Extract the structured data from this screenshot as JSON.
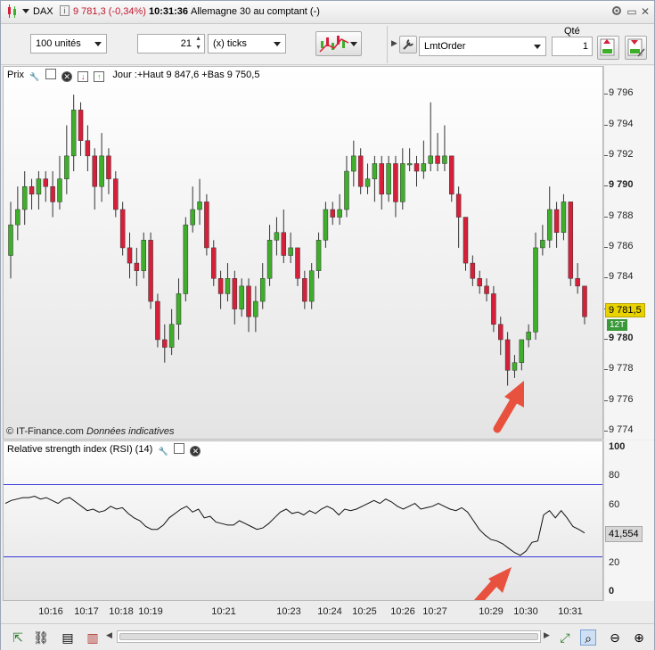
{
  "titlebar": {
    "symbol": "DAX",
    "price_change": "9 781,3 (-0,34%)",
    "time": "10:31:36",
    "instrument": "Allemagne 30 au comptant (-)"
  },
  "toolbar": {
    "quantity_units": "100 unités",
    "ticks_value": "21",
    "ticks_unit": "(x) ticks",
    "order_type": "LmtOrder",
    "qty_label": "Qté",
    "qty_value": "1"
  },
  "price_panel": {
    "label": "Prix",
    "info": "Jour :+Haut 9 847,6 +Bas 9 750,5",
    "credit_source": "© IT-Finance.com",
    "credit_note": "Données indicatives",
    "y_ticks": [
      "9 796",
      "9 794",
      "9 792",
      "9 790",
      "9 788",
      "9 786",
      "9 784",
      "9 782",
      "9 780",
      "9 778",
      "9 776",
      "9 774"
    ],
    "current_price": "9 781,5",
    "tick_badge": "12T"
  },
  "rsi_panel": {
    "label": "Relative strength index (RSI) (14)",
    "y_ticks": [
      "100",
      "80",
      "60",
      "40",
      "20",
      "0"
    ],
    "current_value": "41,554"
  },
  "x_axis": {
    "labels": [
      "10:16",
      "10:17",
      "10:18",
      "10:19",
      "10:21",
      "10:23",
      "10:24",
      "10:25",
      "10:26",
      "10:27",
      "10:29",
      "10:30",
      "10:31"
    ]
  },
  "colors": {
    "up_candle": "#3fae2a",
    "down_candle": "#d6203a",
    "rsi_band": "#3b3bd6",
    "arrow": "#e8513e",
    "price_tag": "#e8d200"
  },
  "chart_data": [
    {
      "type": "candlestick",
      "title": "",
      "ylim": [
        9774,
        9797
      ],
      "x_labels": [
        "10:16",
        "10:17",
        "10:18",
        "10:19",
        "10:21",
        "10:23",
        "10:24",
        "10:25",
        "10:26",
        "10:27",
        "10:29",
        "10:30",
        "10:31"
      ],
      "candles": [
        [
          9785.5,
          9787.5,
          9784,
          9789
        ],
        [
          9787.5,
          9788.5,
          9786.5,
          9790
        ],
        [
          9788.5,
          9790,
          9787.5,
          9791
        ],
        [
          9790,
          9789.5,
          9788.5,
          9790.5
        ],
        [
          9789.5,
          9790.5,
          9788.5,
          9791
        ],
        [
          9790.5,
          9790,
          9789,
          9791
        ],
        [
          9790,
          9789,
          9788,
          9791
        ],
        [
          9789,
          9790.5,
          9788.5,
          9792
        ],
        [
          9790.5,
          9792,
          9789.5,
          9794
        ],
        [
          9792,
          9795,
          9791,
          9796
        ],
        [
          9795,
          9793,
          9792,
          9795.5
        ],
        [
          9793,
          9792,
          9791,
          9794
        ],
        [
          9792,
          9790,
          9788.5,
          9792.5
        ],
        [
          9790,
          9792,
          9789,
          9793.5
        ],
        [
          9792,
          9790.5,
          9789.5,
          9792.5
        ],
        [
          9790.5,
          9788.5,
          9788,
          9791
        ],
        [
          9788.5,
          9786,
          9785.5,
          9789
        ],
        [
          9786,
          9785,
          9784,
          9787
        ],
        [
          9785,
          9784.5,
          9783.5,
          9786
        ],
        [
          9784.5,
          9786.5,
          9784,
          9787
        ],
        [
          9786.5,
          9782.5,
          9782,
          9787
        ],
        [
          9782.5,
          9780,
          9779.5,
          9783
        ],
        [
          9780,
          9779.5,
          9778.5,
          9781
        ],
        [
          9779.5,
          9781,
          9779,
          9782
        ],
        [
          9781,
          9783,
          9780,
          9784
        ],
        [
          9783,
          9787.5,
          9782.5,
          9788
        ],
        [
          9787.5,
          9788.5,
          9787,
          9790
        ],
        [
          9788.5,
          9789,
          9787.5,
          9790.5
        ],
        [
          9789,
          9786,
          9785.5,
          9789.5
        ],
        [
          9786,
          9784,
          9783.5,
          9786.5
        ],
        [
          9784,
          9783,
          9782,
          9784.5
        ],
        [
          9783,
          9784,
          9782.5,
          9785
        ],
        [
          9784,
          9782,
          9781,
          9784.5
        ],
        [
          9782,
          9783.5,
          9781.5,
          9784
        ],
        [
          9783.5,
          9781.5,
          9780.5,
          9784
        ],
        [
          9781.5,
          9782.5,
          9780.5,
          9783.5
        ],
        [
          9782.5,
          9784,
          9782,
          9785
        ],
        [
          9784,
          9786.5,
          9783.5,
          9787.5
        ],
        [
          9786.5,
          9787,
          9785.5,
          9788
        ],
        [
          9787,
          9785.5,
          9785,
          9788.5
        ],
        [
          9785.5,
          9786,
          9785,
          9787
        ],
        [
          9786,
          9784,
          9783.5,
          9786
        ],
        [
          9784,
          9782.5,
          9782,
          9784.5
        ],
        [
          9782.5,
          9784.5,
          9782,
          9785
        ],
        [
          9784.5,
          9786.5,
          9784,
          9787
        ],
        [
          9786.5,
          9788.5,
          9786,
          9789
        ],
        [
          9788.5,
          9788,
          9787.5,
          9789
        ],
        [
          9788,
          9788.5,
          9787.5,
          9789.5
        ],
        [
          9788.5,
          9791,
          9788,
          9792
        ],
        [
          9791,
          9792,
          9790,
          9793
        ],
        [
          9792,
          9790,
          9789.5,
          9792.5
        ],
        [
          9790,
          9790.5,
          9789.5,
          9791.5
        ],
        [
          9790.5,
          9791.5,
          9789,
          9792
        ],
        [
          9791.5,
          9789.5,
          9788.5,
          9792
        ],
        [
          9789.5,
          9791.5,
          9789,
          9792
        ],
        [
          9791.5,
          9789,
          9788,
          9792
        ],
        [
          9789,
          9791.5,
          9788.5,
          9792.5
        ],
        [
          9791.5,
          9791.5,
          9791,
          9792.5
        ],
        [
          9791.5,
          9791,
          9790,
          9792
        ],
        [
          9791,
          9791.5,
          9790.5,
          9793
        ],
        [
          9791.5,
          9792,
          9791,
          9795.5
        ],
        [
          9792,
          9791.5,
          9791,
          9793.5
        ],
        [
          9791.5,
          9792,
          9791,
          9794
        ],
        [
          9792,
          9789.5,
          9789,
          9792
        ],
        [
          9789.5,
          9788,
          9786,
          9790
        ],
        [
          9788,
          9785,
          9784.5,
          9788
        ],
        [
          9785,
          9784,
          9783.5,
          9785.5
        ],
        [
          9784,
          9783.5,
          9783,
          9784.5
        ],
        [
          9783.5,
          9783,
          9782.5,
          9784
        ],
        [
          9783,
          9781,
          9780.5,
          9783.5
        ],
        [
          9781,
          9780,
          9779,
          9781.5
        ],
        [
          9780,
          9778,
          9777,
          9780.5
        ],
        [
          9778,
          9778.5,
          9777.5,
          9779
        ],
        [
          9778.5,
          9780,
          9778,
          9780
        ],
        [
          9780,
          9780.5,
          9779.5,
          9781
        ],
        [
          9780.5,
          9786,
          9780,
          9787
        ],
        [
          9786,
          9786.5,
          9785.5,
          9787.5
        ],
        [
          9786.5,
          9788.5,
          9786,
          9790
        ],
        [
          9788.5,
          9787,
          9786,
          9789
        ],
        [
          9787,
          9789,
          9786.5,
          9789.5
        ],
        [
          9789,
          9784,
          9783.5,
          9789
        ],
        [
          9784,
          9783.5,
          9783,
          9785
        ],
        [
          9783.5,
          9781.5,
          9781,
          9783.5
        ]
      ]
    },
    {
      "type": "line",
      "title": "",
      "ylim": [
        0,
        100
      ],
      "bands": [
        25,
        75
      ],
      "series": [
        {
          "values": [
            62,
            64,
            65,
            66,
            66,
            67,
            65,
            66,
            64,
            62,
            65,
            66,
            63,
            60,
            57,
            58,
            56,
            57,
            60,
            58,
            59,
            55,
            52,
            50,
            46,
            44,
            44,
            47,
            52,
            55,
            58,
            60,
            56,
            58,
            52,
            53,
            49,
            48,
            47,
            47,
            50,
            48,
            46,
            44,
            45,
            48,
            52,
            56,
            58,
            55,
            56,
            54,
            57,
            55,
            58,
            60,
            58,
            54,
            58,
            57,
            58,
            60,
            62,
            64,
            62,
            65,
            63,
            60,
            58,
            60,
            62,
            58,
            59,
            60,
            62,
            60,
            58,
            57,
            59,
            56,
            50,
            44,
            40,
            37,
            36,
            34,
            31,
            28,
            26,
            29,
            35,
            36,
            54,
            57,
            52,
            57,
            52,
            46,
            44,
            41.554
          ]
        }
      ]
    }
  ]
}
